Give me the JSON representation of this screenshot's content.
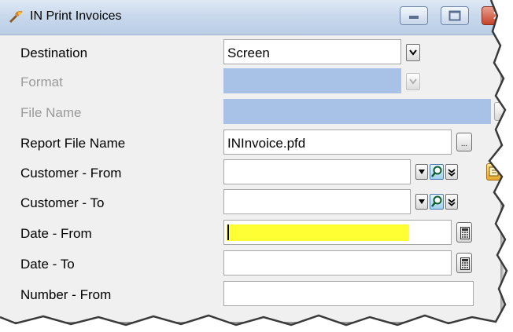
{
  "window": {
    "title": "IN Print Invoices",
    "minimize_icon": "minimize-icon",
    "maximize_icon": "maximize-icon",
    "close_icon": "close-icon",
    "close_glyph": "✕"
  },
  "form": {
    "destination_label": "Destination",
    "destination_value": "Screen",
    "format_label": "Format",
    "format_value": "",
    "file_name_label": "File Name",
    "file_name_value": "",
    "report_file_label": "Report File Name",
    "report_file_value": "INInvoice.pfd",
    "customer_from_label": "Customer - From",
    "customer_from_value": "",
    "customer_to_label": "Customer - To",
    "customer_to_value": "",
    "date_from_label": "Date - From",
    "date_from_value": "",
    "date_to_label": "Date - To",
    "date_to_value": "",
    "number_from_label": "Number - From",
    "number_from_value": "",
    "browse_glyph": "...",
    "browse_glyph_disabled": "..."
  },
  "colors": {
    "disabled_field": "#a8c1e6",
    "highlight_field": "#ffff33",
    "titlebar": "#c9d9ec"
  }
}
